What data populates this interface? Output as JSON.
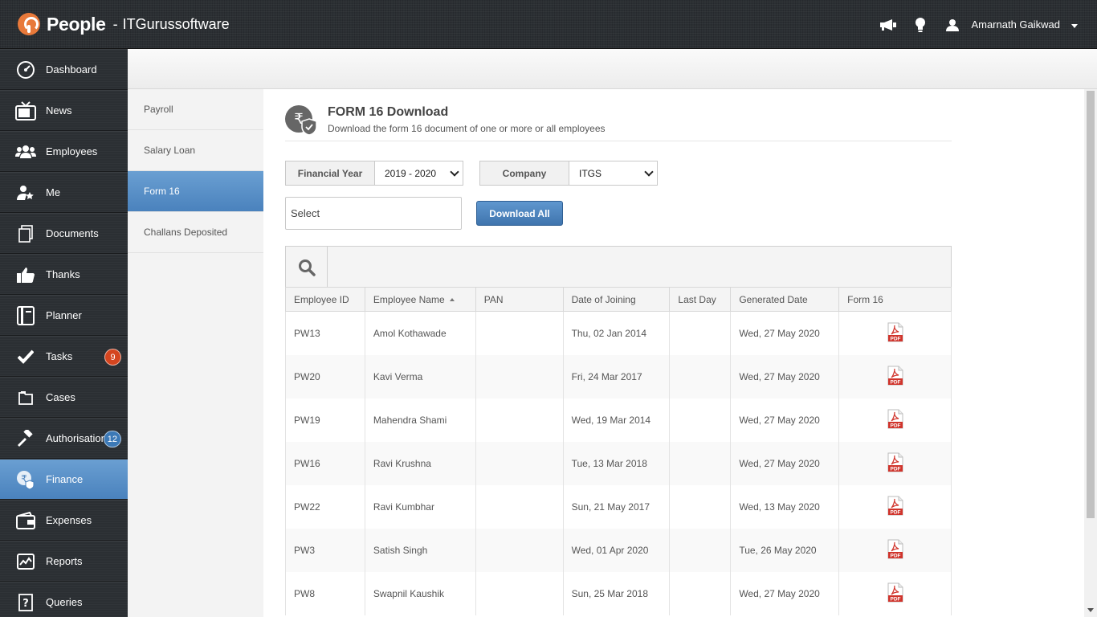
{
  "header": {
    "app_name": "People",
    "separator": "-",
    "company": "ITGurussoftware",
    "user_name": "Amarnath Gaikwad"
  },
  "nav": {
    "items": [
      {
        "label": "Dashboard",
        "icon": "dashboard-icon"
      },
      {
        "label": "News",
        "icon": "tv-icon"
      },
      {
        "label": "Employees",
        "icon": "users-icon"
      },
      {
        "label": "Me",
        "icon": "user-star-icon"
      },
      {
        "label": "Documents",
        "icon": "documents-icon"
      },
      {
        "label": "Thanks",
        "icon": "thumbs-up-icon"
      },
      {
        "label": "Planner",
        "icon": "planner-icon"
      },
      {
        "label": "Tasks",
        "icon": "check-icon",
        "badge": "9"
      },
      {
        "label": "Cases",
        "icon": "folder-icon"
      },
      {
        "label": "Authorisations",
        "icon": "gavel-icon",
        "badge": "12"
      },
      {
        "label": "Finance",
        "icon": "rupee-shield-icon",
        "active": true
      },
      {
        "label": "Expenses",
        "icon": "wallet-icon"
      },
      {
        "label": "Reports",
        "icon": "chart-icon"
      },
      {
        "label": "Queries",
        "icon": "question-icon"
      }
    ]
  },
  "subnav": {
    "items": [
      {
        "label": "Payroll"
      },
      {
        "label": "Salary Loan"
      },
      {
        "label": "Form 16",
        "active": true
      },
      {
        "label": "Challans Deposited"
      }
    ]
  },
  "page": {
    "title": "FORM 16 Download",
    "subtitle": "Download the form 16 document of one or more or all employees",
    "financial_year_label": "Financial Year",
    "financial_year_value": "2019 - 2020",
    "company_label": "Company",
    "company_value": "ITGS",
    "employee_select_placeholder": "Select",
    "download_all_label": "Download All"
  },
  "table": {
    "columns": [
      "Employee ID",
      "Employee Name",
      "PAN",
      "Date of Joining",
      "Last Day",
      "Generated Date",
      "Form 16"
    ],
    "rows": [
      {
        "id": "PW13",
        "name": "Amol Kothawade",
        "pan": "",
        "doj": "Thu, 02 Jan 2014",
        "last_day": "",
        "generated": "Wed, 27 May 2020",
        "form16": "PDF"
      },
      {
        "id": "PW20",
        "name": "Kavi Verma",
        "pan": "",
        "doj": "Fri, 24 Mar 2017",
        "last_day": "",
        "generated": "Wed, 27 May 2020",
        "form16": "PDF"
      },
      {
        "id": "PW19",
        "name": "Mahendra Shami",
        "pan": "",
        "doj": "Wed, 19 Mar 2014",
        "last_day": "",
        "generated": "Wed, 27 May 2020",
        "form16": "PDF"
      },
      {
        "id": "PW16",
        "name": "Ravi Krushna",
        "pan": "",
        "doj": "Tue, 13 Mar 2018",
        "last_day": "",
        "generated": "Wed, 27 May 2020",
        "form16": "PDF"
      },
      {
        "id": "PW22",
        "name": "Ravi Kumbhar",
        "pan": "",
        "doj": "Sun, 21 May 2017",
        "last_day": "",
        "generated": "Wed, 13 May 2020",
        "form16": "PDF"
      },
      {
        "id": "PW3",
        "name": "Satish Singh",
        "pan": "",
        "doj": "Wed, 01 Apr 2020",
        "last_day": "",
        "generated": "Tue, 26 May 2020",
        "form16": "PDF"
      },
      {
        "id": "PW8",
        "name": "Swapnil Kaushik",
        "pan": "",
        "doj": "Sun, 25 Mar 2018",
        "last_day": "",
        "generated": "Wed, 27 May 2020",
        "form16": "PDF"
      }
    ]
  },
  "colors": {
    "accent": "#4a82bd",
    "topbar": "#2b2f33",
    "badge_tasks": "#d4451f",
    "badge_auth": "#3c79b6",
    "pdf_red": "#d0342c"
  }
}
